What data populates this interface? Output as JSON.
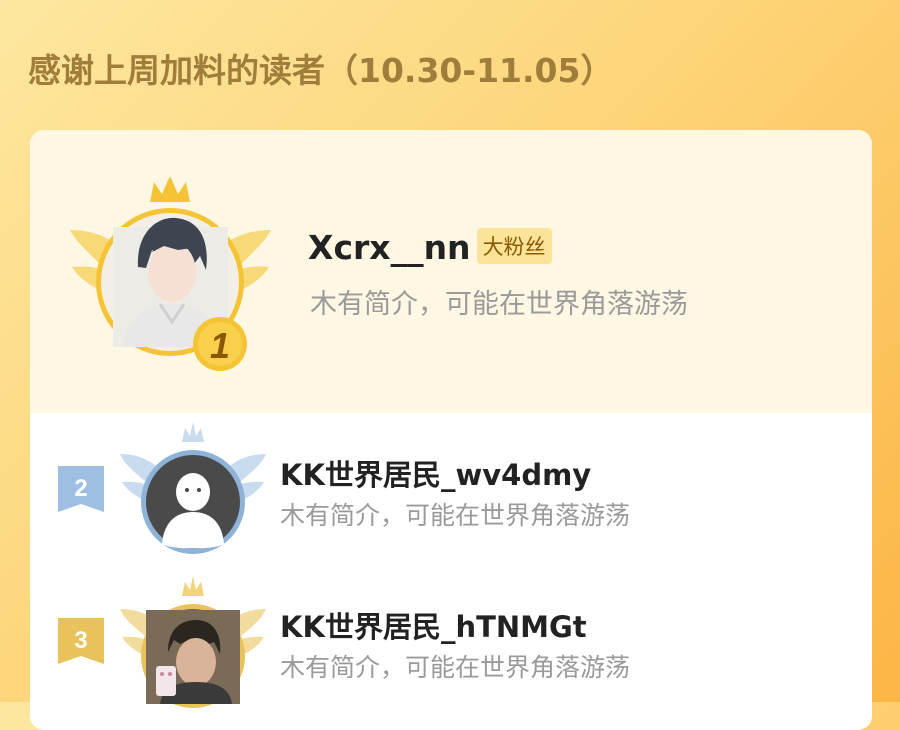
{
  "header": {
    "title": "感谢上周加料的读者（10.30-11.05）"
  },
  "colors": {
    "rank1": "#f5c434",
    "rank2": "#8fb2d8",
    "rank3": "#e8c25b",
    "name": "#222222",
    "bio": "#9a9a9a",
    "badge_bg": "#fbe49a"
  },
  "readers": [
    {
      "rank": "1",
      "name": "Xcrx__nn",
      "badge": "大粉丝",
      "bio": "木有简介，可能在世界角落游荡",
      "avatar": "illustrated-boy-avatar"
    },
    {
      "rank": "2",
      "name": "KK世界居民_wv4dmy",
      "bio": "木有简介，可能在世界角落游荡",
      "avatar": "default-person-avatar"
    },
    {
      "rank": "3",
      "name": "KK世界居民_hTNMGt",
      "bio": "木有简介，可能在世界角落游荡",
      "avatar": "selfie-photo-avatar"
    }
  ]
}
